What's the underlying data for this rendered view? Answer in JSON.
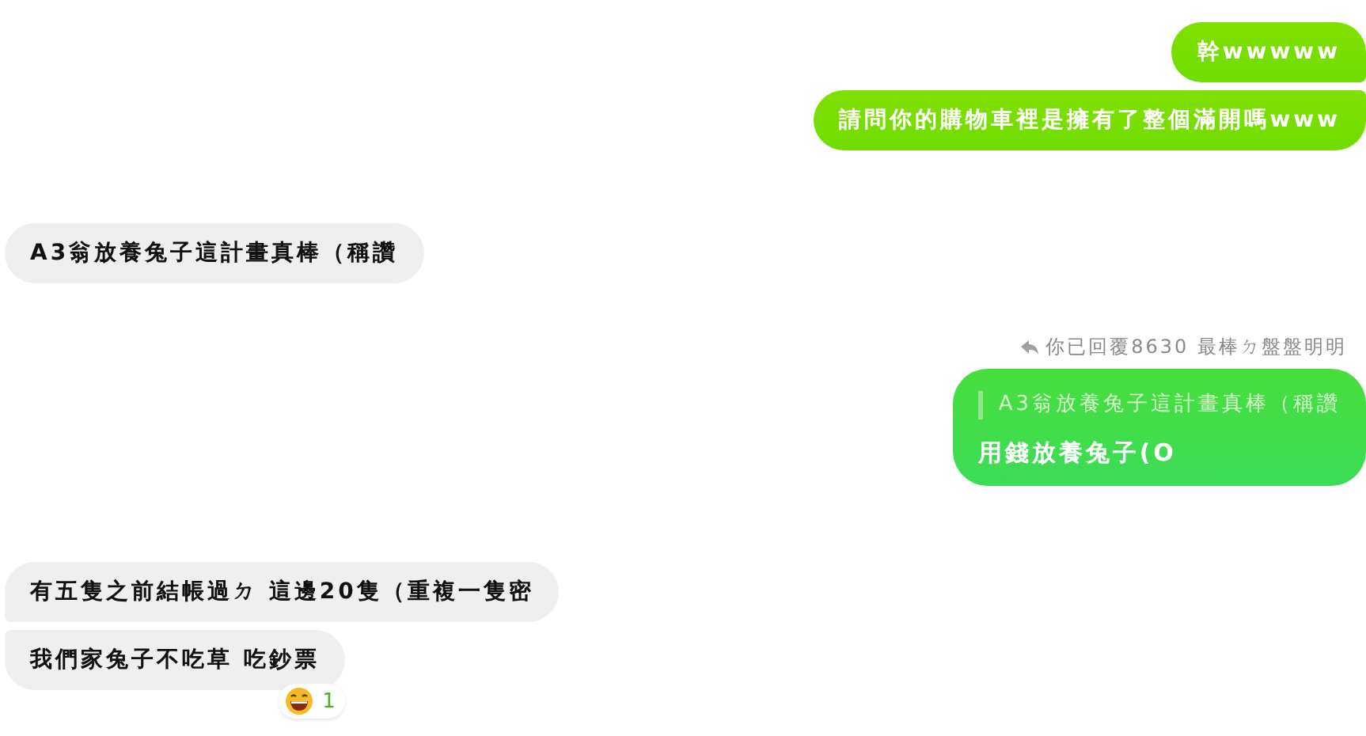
{
  "groups": [
    {
      "kind": "outgoing",
      "messages": [
        {
          "text": "幹wwwww"
        },
        {
          "text": "請問你的購物車裡是擁有了整個滿開嗎www"
        }
      ]
    },
    {
      "kind": "incoming",
      "messages": [
        {
          "text": "A3翁放養兔子這計畫真棒（稱讚"
        }
      ]
    },
    {
      "kind": "outgoing",
      "reply_label": "你已回覆8630 最棒ㄉ盤盤明明",
      "messages": [
        {
          "quote": "A3翁放養兔子這計畫真棒（稱讚",
          "text": "用錢放養兔子(O"
        }
      ]
    },
    {
      "kind": "incoming",
      "messages": [
        {
          "text": "有五隻之前結帳過ㄉ 這邊20隻（重複一隻密"
        },
        {
          "text": "我們家兔子不吃草 吃鈔票",
          "reaction": {
            "count": "1"
          }
        }
      ]
    }
  ]
}
